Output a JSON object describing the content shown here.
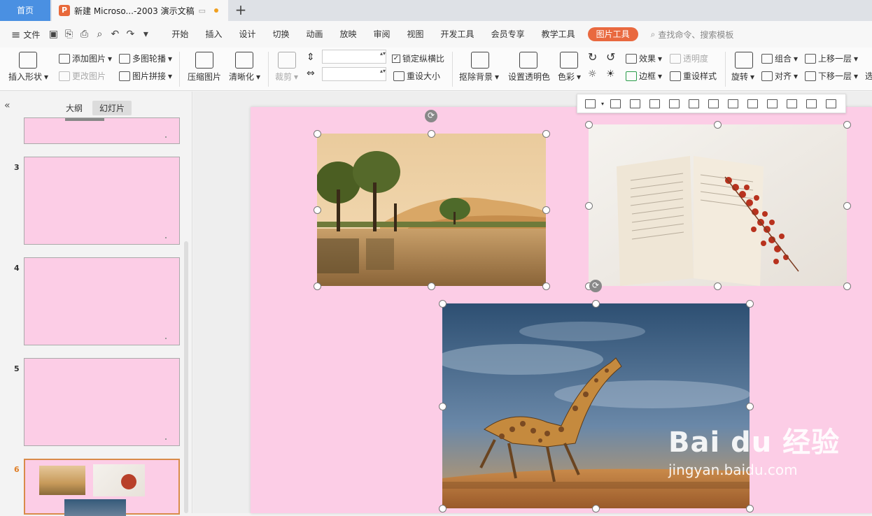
{
  "tabs": {
    "home": "首页",
    "doc_logo": "P",
    "doc_title": "新建 Microso...-2003 演示文稿",
    "add": "+"
  },
  "menu": {
    "file": "文件",
    "items": [
      "开始",
      "插入",
      "设计",
      "切换",
      "动画",
      "放映",
      "审阅",
      "视图",
      "开发工具",
      "会员专享",
      "教学工具"
    ],
    "active": "图片工具",
    "search": "查找命令、搜索模板"
  },
  "ribbon": {
    "insert_shape": "插入形状",
    "add_picture": "添加图片",
    "change_picture": "更改图片",
    "multi_carousel": "多图轮播",
    "picture_join": "图片拼接",
    "compress": "压缩图片",
    "sharpen": "清晰化",
    "crop": "裁剪",
    "lock_ratio": "锁定纵横比",
    "reset_size": "重设大小",
    "remove_bg": "抠除背景",
    "set_transparent": "设置透明色",
    "color": "色彩",
    "effect": "效果",
    "transparency": "透明度",
    "border": "边框",
    "reset_style": "重设样式",
    "rotate": "旋转",
    "group": "组合",
    "align": "对齐",
    "bring_forward": "上移一层",
    "send_backward": "下移一层",
    "select_cut": "选"
  },
  "panel": {
    "outline": "大纲",
    "slides": "幻灯片",
    "slide_numbers": [
      "3",
      "4",
      "5",
      "6"
    ]
  },
  "watermark": {
    "logo": "Bai du 经验",
    "url": "jingyan.baidu.com"
  },
  "colors": {
    "accent": "#e9693f",
    "slide_bg": "#fccde6",
    "home_tab": "#4a90e2"
  }
}
